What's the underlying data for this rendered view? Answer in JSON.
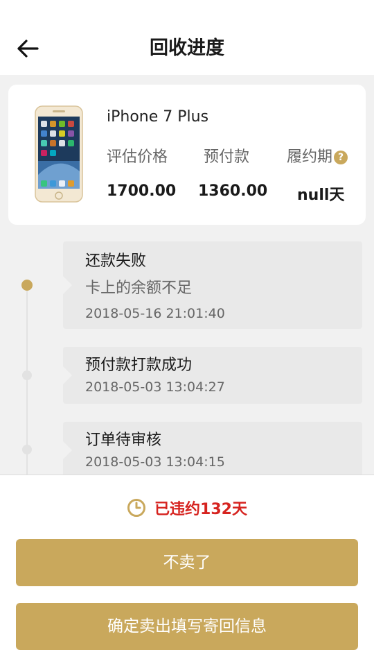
{
  "header": {
    "title": "回收进度"
  },
  "product": {
    "name": "iPhone 7 Plus",
    "metrics": [
      {
        "label": "评估价格",
        "value": "1700.00"
      },
      {
        "label": "预付款",
        "value": "1360.00"
      },
      {
        "label": "履约期",
        "value": "null天",
        "help": "?"
      }
    ]
  },
  "timeline": [
    {
      "title": "还款失败",
      "desc": "卡上的余额不足",
      "time": "2018-05-16 21:01:40",
      "status": "active"
    },
    {
      "title": "预付款打款成功",
      "desc": "",
      "time": "2018-05-03 13:04:27",
      "status": "inactive"
    },
    {
      "title": "订单待审核",
      "desc": "",
      "time": "2018-05-03 13:04:15",
      "status": "inactive"
    }
  ],
  "footer": {
    "breach_text": "已违约132天",
    "cancel_label": "不卖了",
    "confirm_label": "确定卖出填写寄回信息"
  },
  "colors": {
    "accent": "#c9a85c",
    "danger": "#d6231f",
    "background": "#f1f1f1"
  }
}
